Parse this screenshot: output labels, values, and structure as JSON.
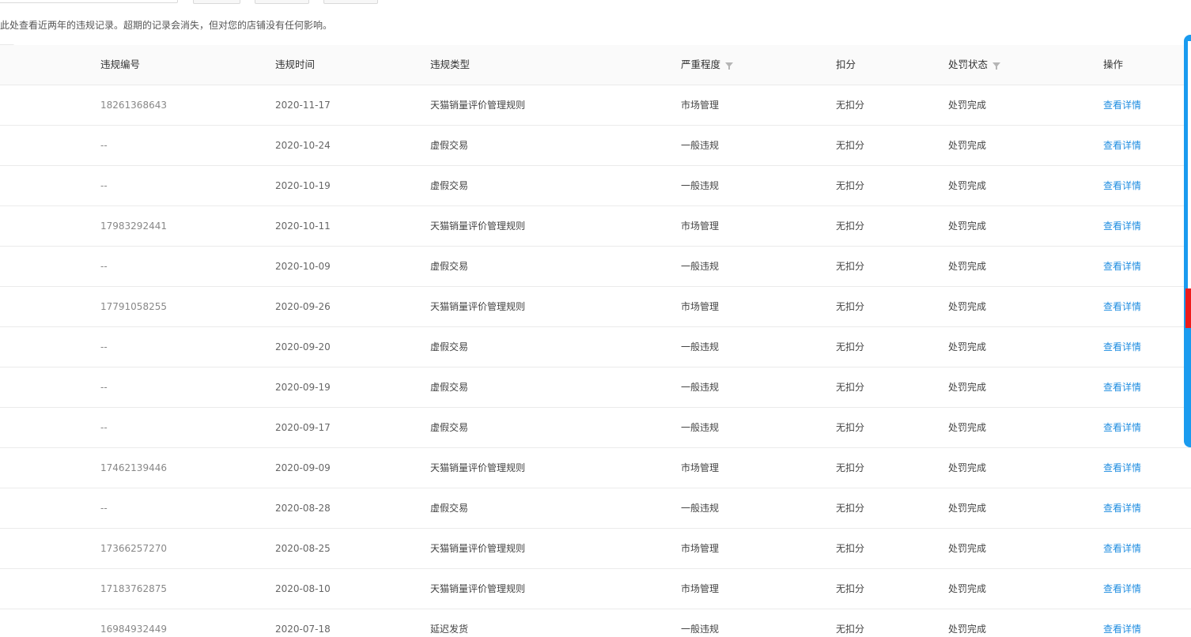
{
  "notice": "此处查看近两年的违规记录。超期的记录会消失，但对您的店铺没有任何影响。",
  "table": {
    "headers": {
      "id": "违规编号",
      "time": "违规时间",
      "type": "违规类型",
      "severity": "严重程度",
      "points": "扣分",
      "status": "处罚状态",
      "operation": "操作"
    },
    "rows": [
      {
        "id": "18261368643",
        "time": "2020-11-17",
        "type": "天猫销量评价管理规则",
        "severity": "市场管理",
        "points": "无扣分",
        "status": "处罚完成",
        "op": "查看详情"
      },
      {
        "id": "--",
        "time": "2020-10-24",
        "type": "虚假交易",
        "severity": "一般违规",
        "points": "无扣分",
        "status": "处罚完成",
        "op": "查看详情"
      },
      {
        "id": "--",
        "time": "2020-10-19",
        "type": "虚假交易",
        "severity": "一般违规",
        "points": "无扣分",
        "status": "处罚完成",
        "op": "查看详情"
      },
      {
        "id": "17983292441",
        "time": "2020-10-11",
        "type": "天猫销量评价管理规则",
        "severity": "市场管理",
        "points": "无扣分",
        "status": "处罚完成",
        "op": "查看详情"
      },
      {
        "id": "--",
        "time": "2020-10-09",
        "type": "虚假交易",
        "severity": "一般违规",
        "points": "无扣分",
        "status": "处罚完成",
        "op": "查看详情"
      },
      {
        "id": "17791058255",
        "time": "2020-09-26",
        "type": "天猫销量评价管理规则",
        "severity": "市场管理",
        "points": "无扣分",
        "status": "处罚完成",
        "op": "查看详情"
      },
      {
        "id": "--",
        "time": "2020-09-20",
        "type": "虚假交易",
        "severity": "一般违规",
        "points": "无扣分",
        "status": "处罚完成",
        "op": "查看详情"
      },
      {
        "id": "--",
        "time": "2020-09-19",
        "type": "虚假交易",
        "severity": "一般违规",
        "points": "无扣分",
        "status": "处罚完成",
        "op": "查看详情"
      },
      {
        "id": "--",
        "time": "2020-09-17",
        "type": "虚假交易",
        "severity": "一般违规",
        "points": "无扣分",
        "status": "处罚完成",
        "op": "查看详情"
      },
      {
        "id": "17462139446",
        "time": "2020-09-09",
        "type": "天猫销量评价管理规则",
        "severity": "市场管理",
        "points": "无扣分",
        "status": "处罚完成",
        "op": "查看详情"
      },
      {
        "id": "--",
        "time": "2020-08-28",
        "type": "虚假交易",
        "severity": "一般违规",
        "points": "无扣分",
        "status": "处罚完成",
        "op": "查看详情"
      },
      {
        "id": "17366257270",
        "time": "2020-08-25",
        "type": "天猫销量评价管理规则",
        "severity": "市场管理",
        "points": "无扣分",
        "status": "处罚完成",
        "op": "查看详情"
      },
      {
        "id": "17183762875",
        "time": "2020-08-10",
        "type": "天猫销量评价管理规则",
        "severity": "市场管理",
        "points": "无扣分",
        "status": "处罚完成",
        "op": "查看详情"
      },
      {
        "id": "16984932449",
        "time": "2020-07-18",
        "type": "延迟发货",
        "severity": "一般违规",
        "points": "无扣分",
        "status": "处罚完成",
        "op": "查看详情"
      }
    ]
  },
  "colors": {
    "link": "#1f8de0",
    "side_bar": "#1a9bef",
    "side_bar_accent": "#ee1c1c",
    "header_bg": "#fafafa",
    "border": "#ebebeb"
  },
  "icons": {
    "severity_filter": "filter-icon",
    "status_filter": "filter-icon"
  }
}
